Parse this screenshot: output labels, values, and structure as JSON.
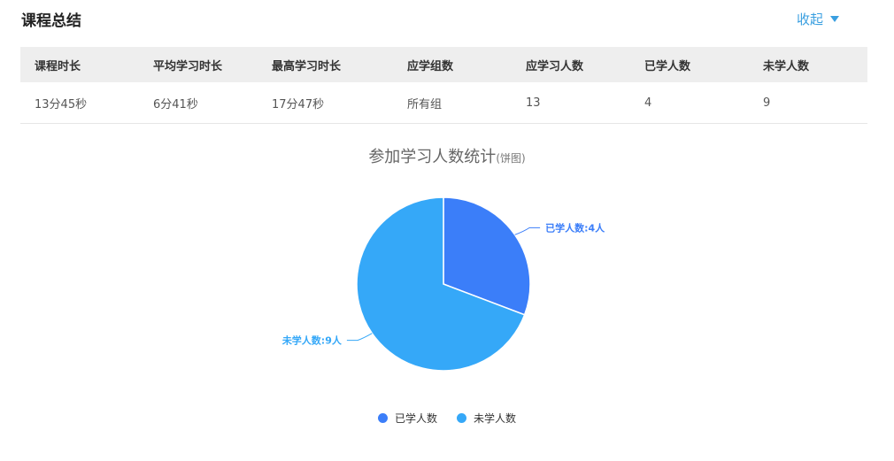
{
  "header": {
    "title": "课程总结",
    "collapse_label": "收起"
  },
  "summary_table": {
    "headers": [
      "课程时长",
      "平均学习时长",
      "最高学习时长",
      "应学组数",
      "应学习人数",
      "已学人数",
      "未学人数"
    ],
    "values": [
      "13分45秒",
      "6分41秒",
      "17分47秒",
      "所有组",
      "13",
      "4",
      "9"
    ]
  },
  "chart_data": {
    "type": "pie",
    "title": "参加学习人数统计",
    "subtitle": "(饼图)",
    "series": [
      {
        "name": "已学人数",
        "value": 4,
        "color": "#3b7ef9",
        "label": "已学人数:4人"
      },
      {
        "name": "未学人数",
        "value": 9,
        "color": "#35a8f8",
        "label": "未学人数:9人"
      }
    ],
    "legend_position": "bottom"
  }
}
